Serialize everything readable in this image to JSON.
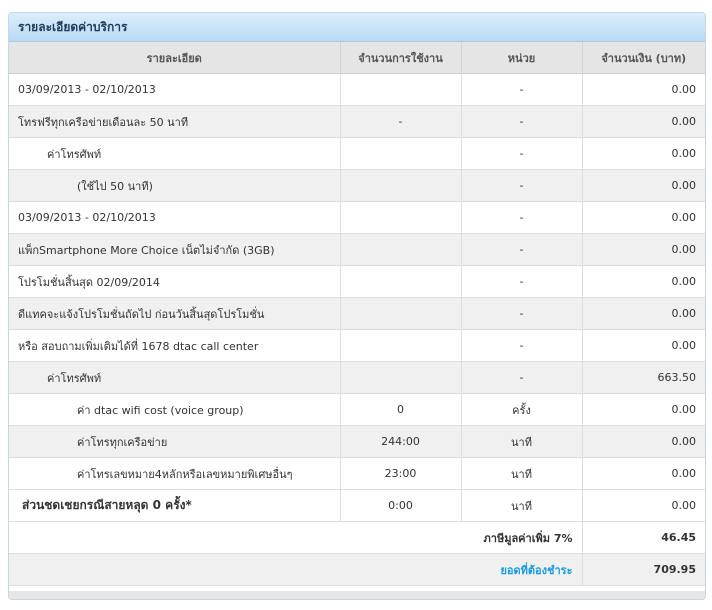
{
  "panel": {
    "title": "รายละเอียดค่าบริการ"
  },
  "columns": [
    "รายละเอียด",
    "จำนวนการใช้งาน",
    "หน่วย",
    "จำนวนเงิน (บาท)"
  ],
  "rows": [
    {
      "detail": "03/09/2013 - 02/10/2013",
      "usage": "",
      "unit": "-",
      "amount": "0.00"
    },
    {
      "detail": "โทรฟรีทุกเครือข่ายเดือนละ 50 นาที",
      "usage": "-",
      "unit": "-",
      "amount": "0.00"
    },
    {
      "detail": "ค่าโทรศัพท์",
      "usage": "",
      "unit": "-",
      "amount": "0.00"
    },
    {
      "detail": "(ใช้ไป 50 นาที)",
      "usage": "",
      "unit": "-",
      "amount": "0.00"
    },
    {
      "detail": "03/09/2013 - 02/10/2013",
      "usage": "",
      "unit": "-",
      "amount": "0.00"
    },
    {
      "detail": "แพ็กSmartphone More Choice เน็ตไม่จำกัด (3GB)",
      "usage": "",
      "unit": "-",
      "amount": "0.00"
    },
    {
      "detail": "โปรโมชั่นสิ้นสุด 02/09/2014",
      "usage": "",
      "unit": "-",
      "amount": "0.00"
    },
    {
      "detail": "ดีแทคจะแจ้งโปรโมชั่นถัดไป ก่อนวันสิ้นสุดโปรโมชั่น",
      "usage": "",
      "unit": "-",
      "amount": "0.00"
    },
    {
      "detail": "หรือ สอบถามเพิ่มเติมได้ที่ 1678 dtac call center",
      "usage": "",
      "unit": "-",
      "amount": "0.00"
    },
    {
      "detail": "ค่าโทรศัพท์",
      "usage": "",
      "unit": "-",
      "amount": "663.50"
    },
    {
      "detail": "ค่า dtac wifi cost (voice group)",
      "usage": "0",
      "unit": "ครั้ง",
      "amount": "0.00"
    },
    {
      "detail": "ค่าโทรทุกเครือข่าย",
      "usage": "244:00",
      "unit": "นาที",
      "amount": "0.00"
    },
    {
      "detail": "ค่าโทรเลขหมาย4หลักหรือเลขหมายพิเศษอื่นๆ",
      "usage": "23:00",
      "unit": "นาที",
      "amount": "0.00"
    },
    {
      "detail": "ส่วนชดเชยกรณีสายหลุด 0 ครั้ง*",
      "usage": "0:00",
      "unit": "นาที",
      "amount": "0.00"
    }
  ],
  "summary": {
    "vat_label": "ภาษีมูลค่าเพิ่ม 7%",
    "vat_amount": "46.45",
    "total_label": "ยอดที่ต้องชำระ",
    "total_amount": "709.95"
  }
}
